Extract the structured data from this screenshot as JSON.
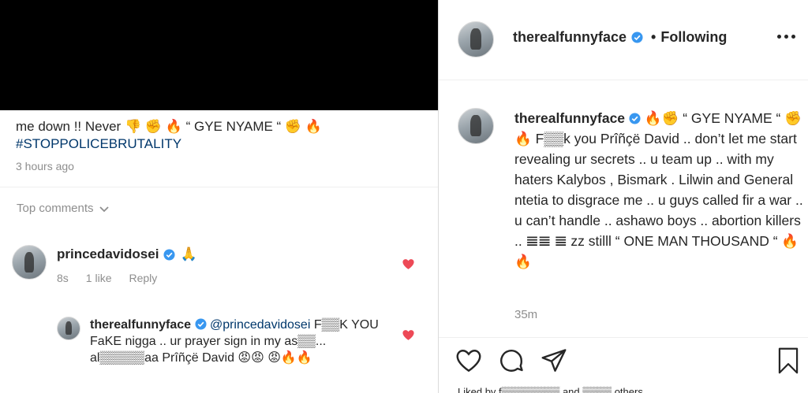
{
  "left": {
    "caption_tail_line1": "me down !! Never 👎 ✊ 🔥 “ GYE NYAME “ ✊ 🔥",
    "hashtag": "#STOPPOLICEBRUTALITY",
    "time_ago": "3 hours ago",
    "top_comments_label": "Top comments",
    "comment1": {
      "username": "princedavidosei",
      "text": "🙏",
      "age": "8s",
      "likes": "1 like",
      "reply_label": "Reply"
    },
    "comment2": {
      "username": "therealfunnyface",
      "mention": "@princedavidosei",
      "text": "F▒▒K YOU FaKE nigga .. ur prayer sign in my as▒▒... al▒▒▒▒▒aa Prîñçë David 😡😡 😡🔥🔥"
    }
  },
  "right": {
    "header": {
      "username": "therealfunnyface",
      "dot": "•",
      "following": "Following"
    },
    "post": {
      "username": "therealfunnyface",
      "caption": "🔥✊ “ GYE NYAME “ ✊🔥 F▒▒k you Prîñçë David .. don’t let me start revealing ur secrets .. u team up .. with my haters Kalybos , Bismark . Lilwin and General ntetia to disgrace me .. u guys called fir a war .. u can’t handle .. ashawo boys .. abortion killers .. 𝌆𝌆 𝌆 zz stilll “ ONE MAN THOUSAND “ 🔥🔥",
      "time": "35m"
    },
    "liked_by": "Liked by f▒▒▒▒▒▒▒▒ and ▒▒▒▒ others"
  },
  "colors": {
    "verified_blue": "#3897f0",
    "heart_red": "#ed4956",
    "muted_text": "#8e8e8e",
    "link_blue": "#00376b"
  },
  "icons": [
    "verified-badge-icon",
    "chevron-down-icon",
    "heart-icon",
    "comment-icon",
    "share-icon",
    "bookmark-icon",
    "more-options-icon"
  ]
}
